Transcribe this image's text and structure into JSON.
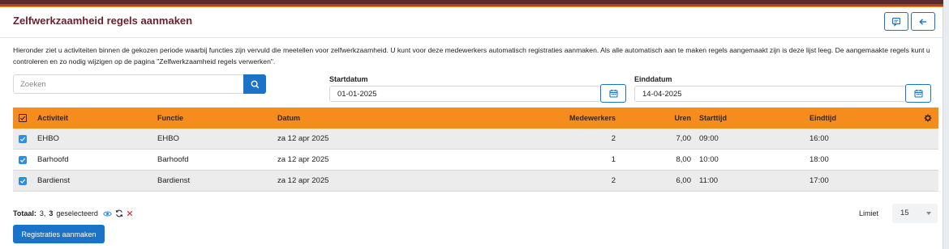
{
  "header": {
    "title": "Zelfwerkzaamheid regels aanmaken",
    "icons": {
      "feedback": "comment-icon",
      "back": "arrow-left-icon"
    }
  },
  "description": "Hieronder ziet u activiteiten binnen de gekozen periode waarbij functies zijn vervuld die meetellen voor zelfwerkzaamheid. U kunt voor deze medewerkers automatisch registraties aanmaken. Als alle automatisch aan te maken regels aangemaakt zijn is deze lijst leeg. De aangemaakte regels kunt u controleren en zo nodig wijzigen op de pagina \"Zelfwerkzaamheid regels verwerken\".",
  "search": {
    "placeholder": "Zoeken",
    "value": ""
  },
  "filters": {
    "start_label": "Startdatum",
    "start_value": "01-01-2025",
    "end_label": "Einddatum",
    "end_value": "14-04-2025"
  },
  "table": {
    "columns": [
      "Activiteit",
      "Functie",
      "Datum",
      "Medewerkers",
      "Uren",
      "Starttijd",
      "Eindtijd"
    ],
    "rows": [
      {
        "activiteit": "EHBO",
        "functie": "EHBO",
        "datum": "za 12 apr 2025",
        "medewerkers": "2",
        "uren": "7,00",
        "starttijd": "09:00",
        "eindtijd": "16:00"
      },
      {
        "activiteit": "Barhoofd",
        "functie": "Barhoofd",
        "datum": "za 12 apr 2025",
        "medewerkers": "1",
        "uren": "8,00",
        "starttijd": "10:00",
        "eindtijd": "18:00"
      },
      {
        "activiteit": "Bardienst",
        "functie": "Bardienst",
        "datum": "za 12 apr 2025",
        "medewerkers": "2",
        "uren": "6,00",
        "starttijd": "11:00",
        "eindtijd": "17:00"
      }
    ]
  },
  "footer": {
    "total_label": "Totaal:",
    "total_count": "3,",
    "selected_count": "3",
    "selected_label": "geselecteerd",
    "limit_label": "Limiet",
    "limit_value": "15",
    "create_button": "Registraties aanmaken"
  },
  "colors": {
    "accent": "#1a73c9",
    "table_header": "#f78c1e",
    "title": "#6b1f2e"
  }
}
